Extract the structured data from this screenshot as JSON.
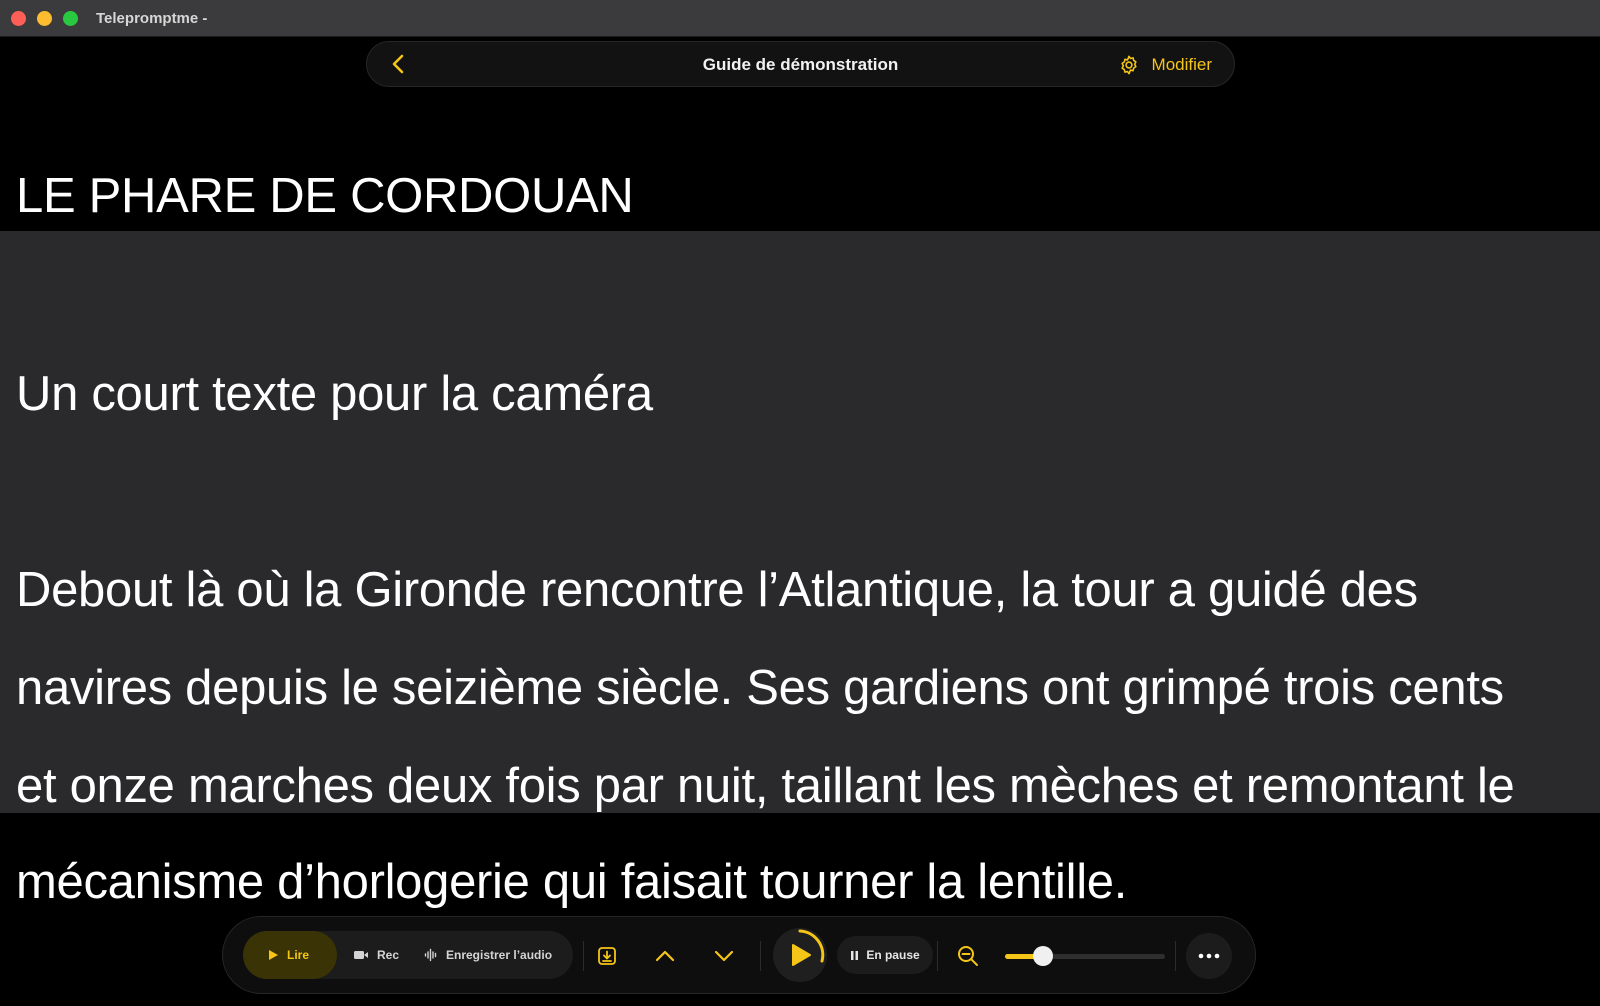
{
  "window": {
    "app_title": "Telepromptme -"
  },
  "header": {
    "back_icon": "chevron-left-icon",
    "title": "Guide de démonstration",
    "edit_icon": "gear-icon",
    "edit_label": "Modifier"
  },
  "script": {
    "lines": [
      "LE PHARE DE CORDOUAN",
      "Un court texte pour la caméra",
      "Debout là où la Gironde rencontre l’Atlantique, la tour a guidé des",
      "navires depuis le seizième siècle. Ses gardiens ont grimpé trois cents",
      "et onze marches deux fois par nuit, taillant les mèches et remontant le",
      "mécanisme d’horlogerie qui faisait tourner la lentille."
    ]
  },
  "controls": {
    "modes": [
      {
        "label": "Lire",
        "icon": "play-icon",
        "active": true
      },
      {
        "label": "Rec",
        "icon": "video-camera-icon",
        "active": false
      },
      {
        "label": "Enregistrer l’audio",
        "icon": "waveform-icon",
        "active": false
      }
    ],
    "import_icon": "download-tray-icon",
    "scroll_up_icon": "chevron-up-icon",
    "scroll_down_icon": "chevron-down-icon",
    "play_icon": "play-icon",
    "status_label": "En pause",
    "status_icon": "pause-icon",
    "zoom_icon": "zoom-out-icon",
    "zoom_level": 0.24,
    "more_icon": "more-horizontal-icon"
  },
  "colors": {
    "accent": "#f5c518",
    "background": "#000000",
    "focus_band": "#2a2a2c",
    "text": "#ffffff"
  }
}
